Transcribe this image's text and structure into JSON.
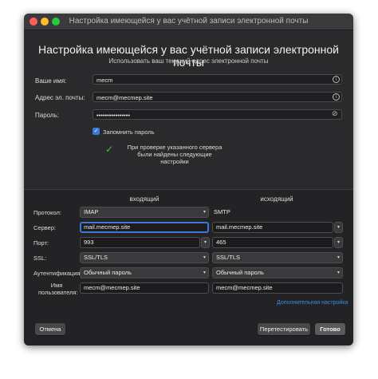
{
  "window": {
    "title": "Настройка имеющейся у вас учётной записи электронной почты"
  },
  "header": {
    "title": "Настройка имеющейся у вас учётной записи электронной почты",
    "subtitle": "Использовать ваш текущий адрес электронной почты"
  },
  "account": {
    "name_label": "Ваше имя:",
    "name_value": "mecm",
    "email_label": "Адрес эл. почты:",
    "email_value": "mecm@mecmep.site",
    "password_label": "Пароль:",
    "password_value": "••••••••••••••••",
    "remember_label": "Запомнить пароль",
    "remember_checked": true,
    "notice": "При проверке указанного сервера были найдены следующие настройки"
  },
  "servers": {
    "incoming_header": "входящий",
    "outgoing_header": "исходящий",
    "protocol_label": "Протокол:",
    "server_label": "Сервер:",
    "port_label": "Порт:",
    "ssl_label": "SSL:",
    "auth_label": "Аутентификация:",
    "username_label": "Имя пользователя:",
    "incoming": {
      "protocol": "IMAP",
      "server": "mail.mecmep.site",
      "port": "993",
      "ssl": "SSL/TLS",
      "auth": "Обычный пароль",
      "username": "mecm@mecmep.site"
    },
    "outgoing": {
      "protocol": "SMTP",
      "server": "mail.mecmep.site",
      "port": "465",
      "ssl": "SSL/TLS",
      "auth": "Обычный пароль",
      "username": "mecm@mecmep.site"
    },
    "advanced_link": "Дополнительная настройка"
  },
  "buttons": {
    "cancel": "Отмена",
    "retest": "Перетестировать",
    "done": "Готово"
  },
  "icons": {
    "info": "info-icon",
    "eye": "eye-slash-icon",
    "check": "checkmark-icon",
    "chevron": "chevron-updown-icon"
  },
  "colors": {
    "accent": "#3b78d8",
    "success": "#3ec43e",
    "link": "#3b8be8"
  }
}
